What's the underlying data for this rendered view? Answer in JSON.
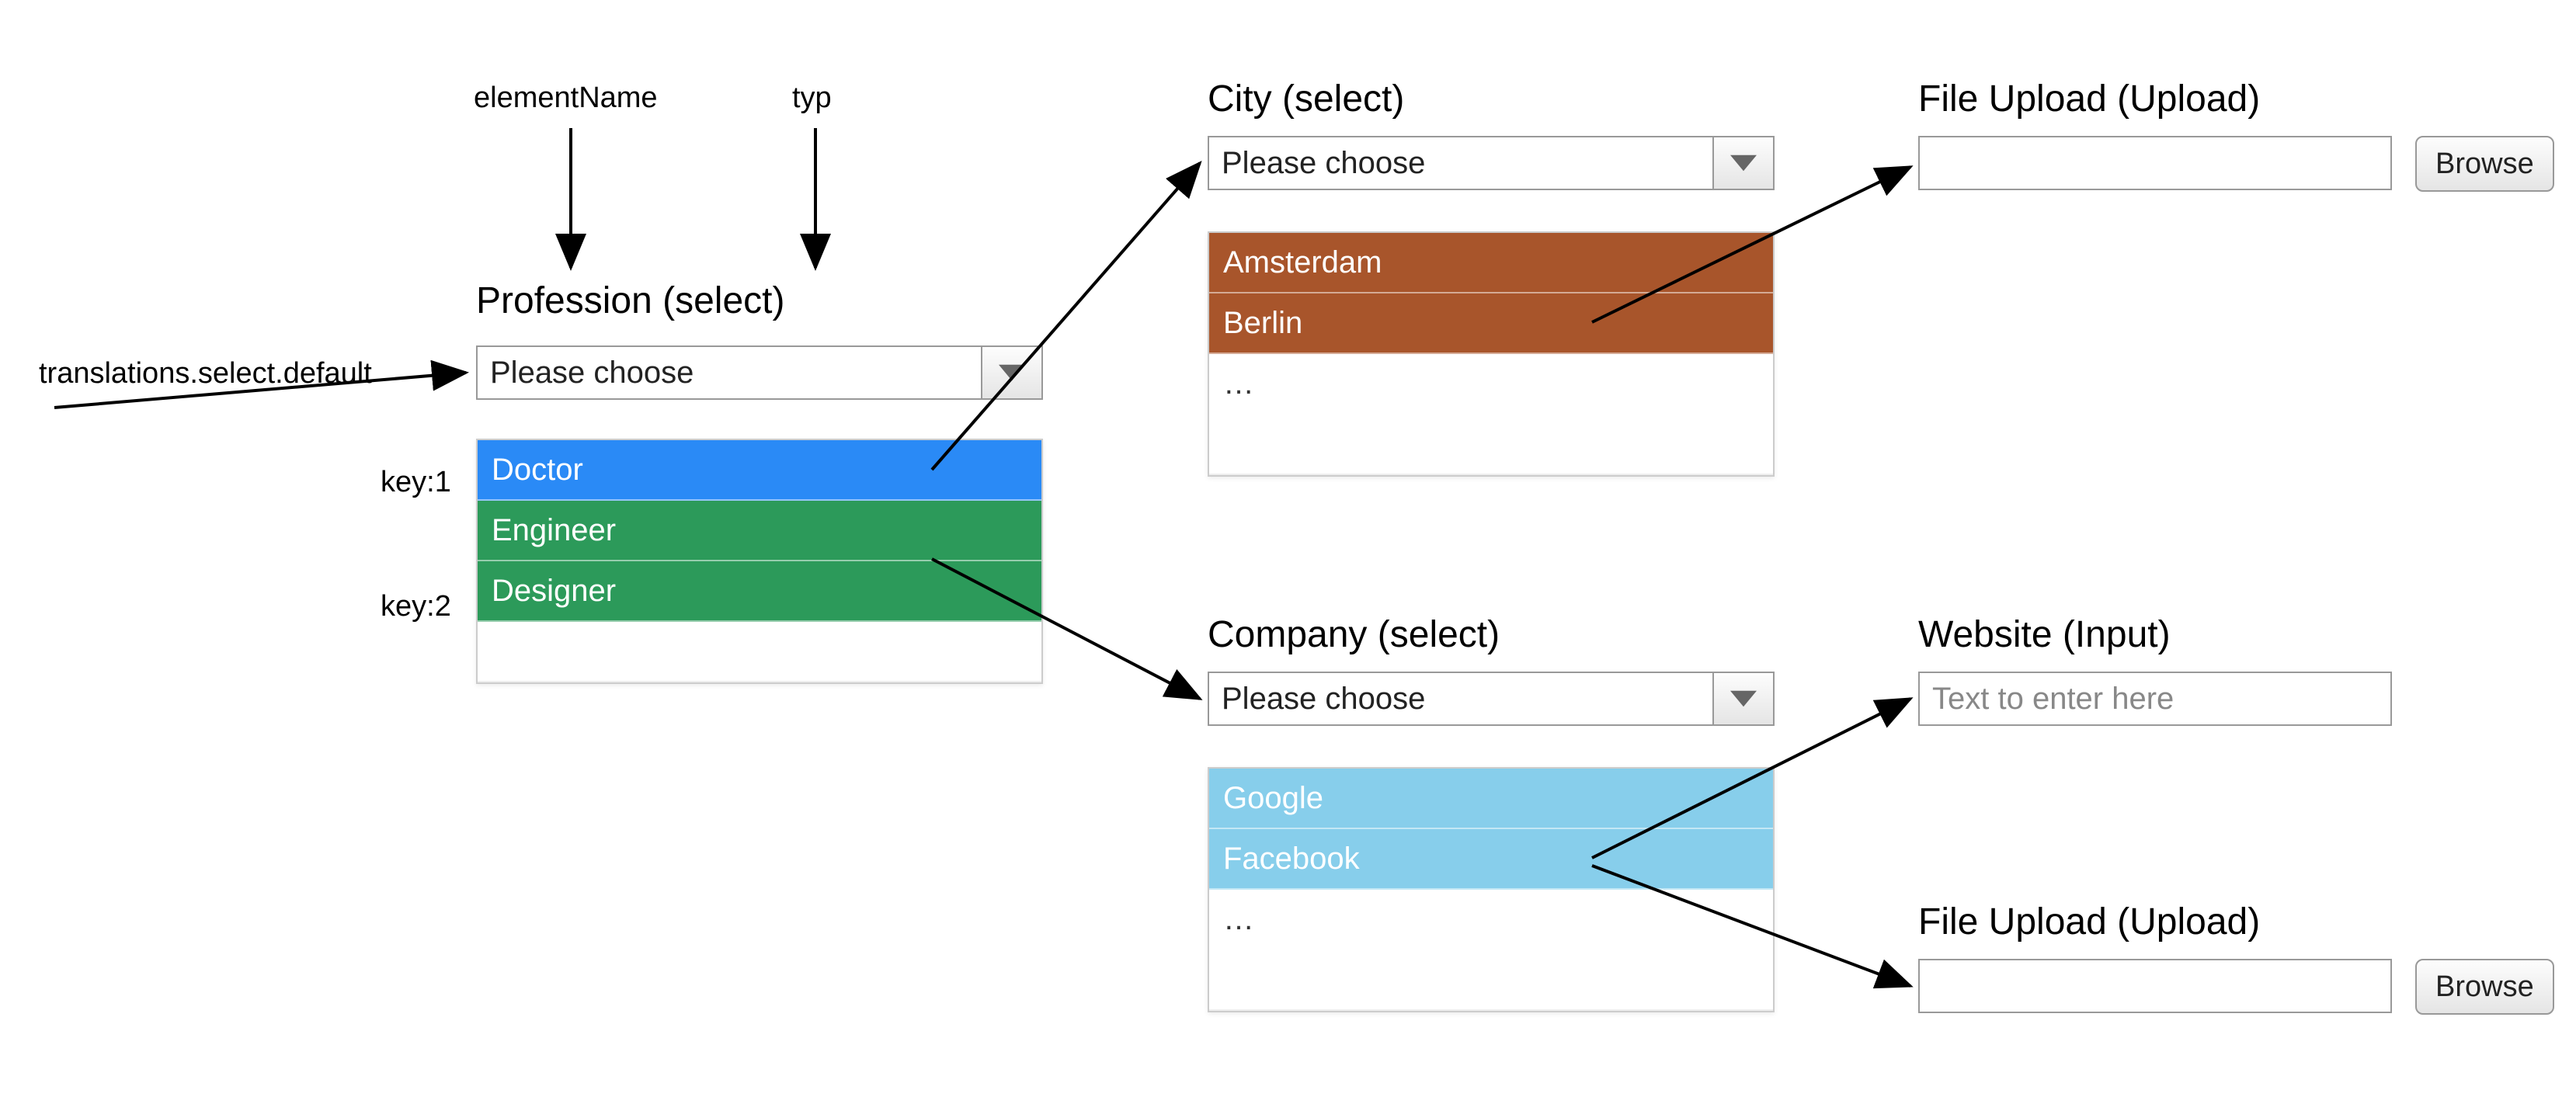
{
  "annotations": {
    "elementName": "elementName",
    "typ": "typ",
    "translationsDefault": "translations.select.default",
    "key1": "key:1",
    "key2": "key:2"
  },
  "profession": {
    "label": "Profession (select)",
    "placeholder": "Please choose",
    "options": [
      "Doctor",
      "Engineer",
      "Designer"
    ]
  },
  "city": {
    "label": "City (select)",
    "placeholder": "Please choose",
    "options": [
      "Amsterdam",
      "Berlin"
    ],
    "ellipsis": "…"
  },
  "company": {
    "label": "Company (select)",
    "placeholder": "Please choose",
    "options": [
      "Google",
      "Facebook"
    ],
    "ellipsis": "…"
  },
  "fileUpload1": {
    "label": "File Upload (Upload)",
    "button": "Browse"
  },
  "website": {
    "label": "Website (Input)",
    "placeholder": "Text to enter here"
  },
  "fileUpload2": {
    "label": "File Upload (Upload)",
    "button": "Browse"
  },
  "colors": {
    "doctor": "#2a8af6",
    "engineer": "#2c9a5a",
    "designer": "#2c9a5a",
    "city": "#a8552b",
    "company": "#87ceeb"
  }
}
